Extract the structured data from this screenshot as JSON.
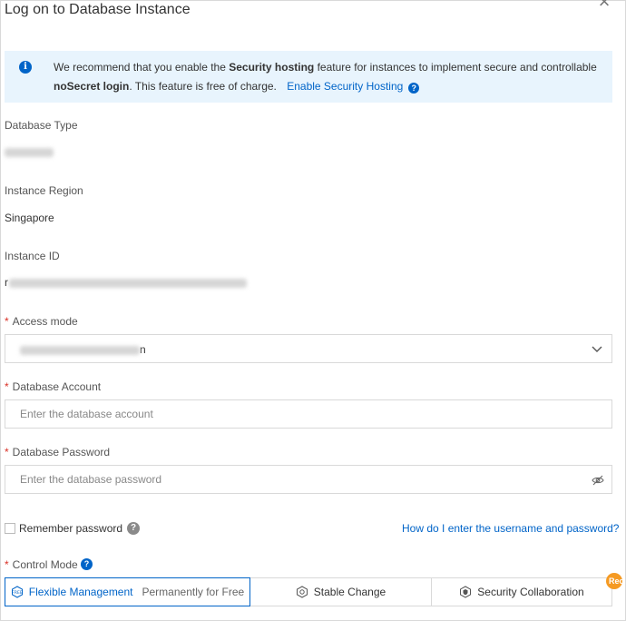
{
  "dialog": {
    "title": "Log on to Database Instance"
  },
  "notice": {
    "text_a": "We recommend that you enable the ",
    "bold_a": "Security hosting",
    "text_b": " feature for instances to implement secure and controllable",
    "bold_b": "noSecret login",
    "text_c": ". This feature is free of charge.",
    "link": "Enable Security Hosting"
  },
  "fields": {
    "db_type_label": "Database Type",
    "region_label": "Instance Region",
    "region_value": "Singapore",
    "instance_id_label": "Instance ID",
    "instance_id_prefix": "r",
    "access_mode_label": "Access mode",
    "access_mode_suffix": "n",
    "account_label": "Database Account",
    "account_placeholder": "Enter the database account",
    "password_label": "Database Password",
    "password_placeholder": "Enter the database password"
  },
  "remember": {
    "label": "Remember password",
    "help_link": "How do I enter the username and password?"
  },
  "control_mode": {
    "label": "Control Mode",
    "options": [
      {
        "label": "Flexible Management",
        "sub": "Permanently for Free"
      },
      {
        "label": "Stable Change"
      },
      {
        "label": "Security Collaboration"
      }
    ],
    "badge": "Rec"
  },
  "colors": {
    "accent": "#0064c8",
    "required": "#d93026",
    "notice_bg": "#e8f4fd",
    "badge": "#f59a23"
  }
}
